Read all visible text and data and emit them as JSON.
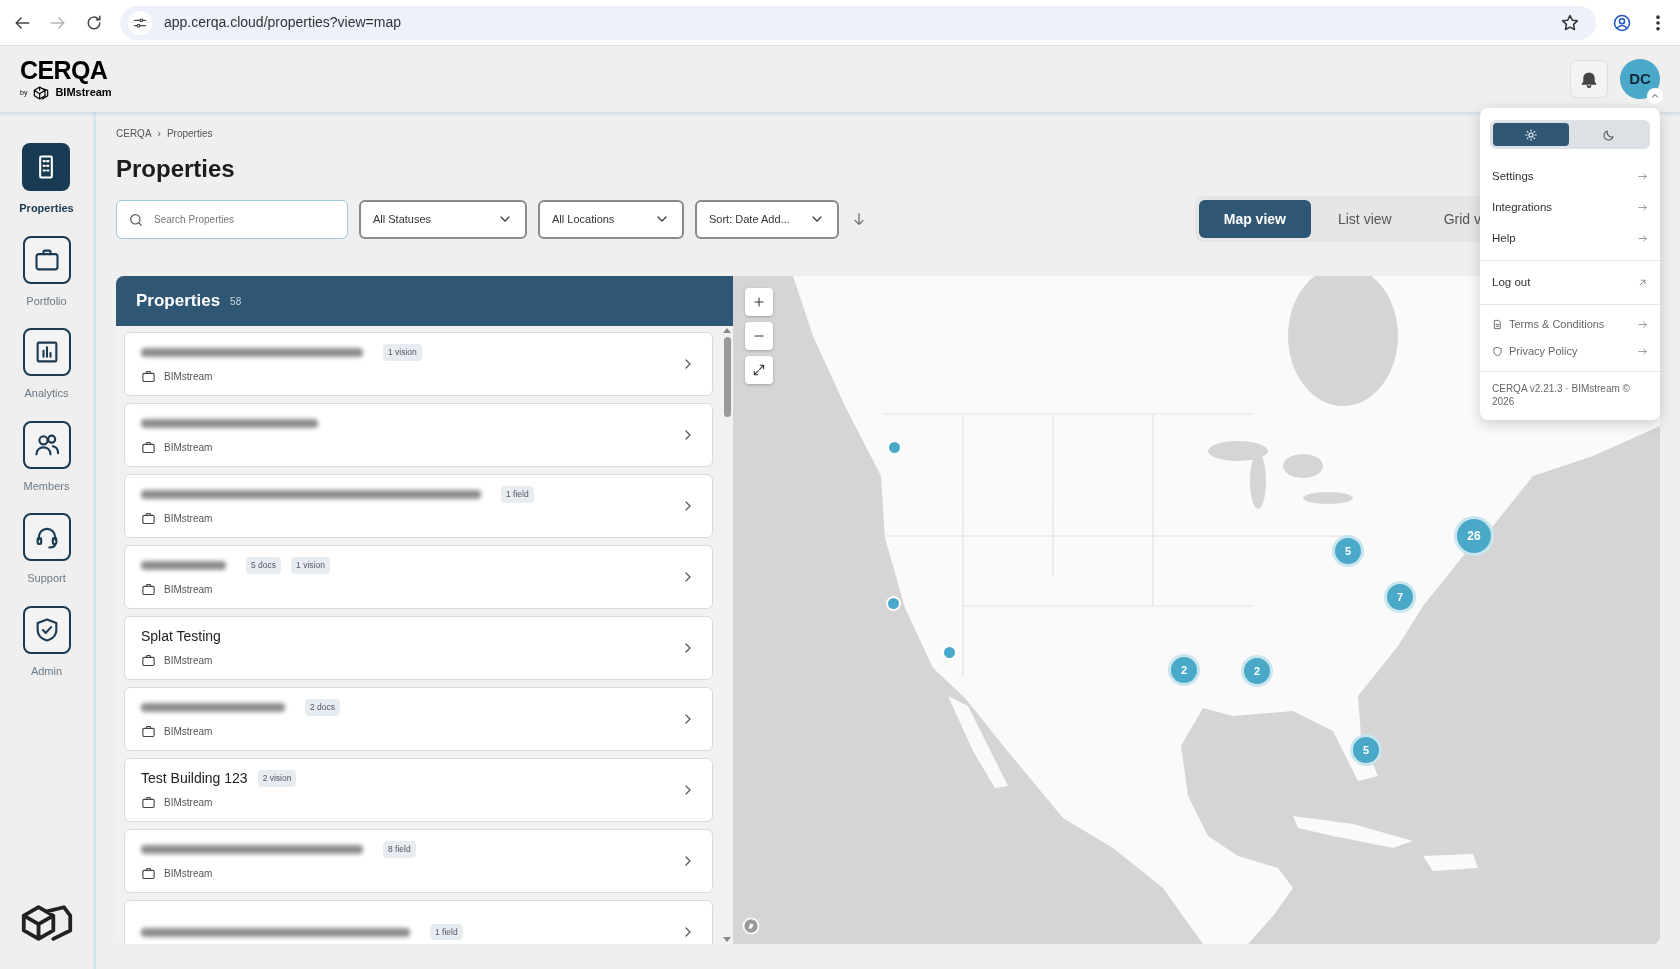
{
  "browser": {
    "url": "app.cerqa.cloud/properties?view=map",
    "forward_disabled": true
  },
  "header": {
    "logo": "CERQA",
    "logo_by": "by",
    "logo_brand": "BIMstream",
    "avatar_initials": "DC",
    "avatar_menu_open": true
  },
  "sidebar": {
    "items": [
      {
        "label": "Properties",
        "selected": true
      },
      {
        "label": "Portfolio",
        "selected": false
      },
      {
        "label": "Analytics",
        "selected": false
      },
      {
        "label": "Members",
        "selected": false
      },
      {
        "label": "Support",
        "selected": false
      },
      {
        "label": "Admin",
        "selected": false
      }
    ]
  },
  "breadcrumb": {
    "items": [
      "CERQA",
      "Properties"
    ],
    "separator": "›"
  },
  "page_title": "Properties",
  "filters": {
    "search_placeholder": "Search Properties",
    "dropdowns": [
      "All Statuses",
      "All Locations",
      "Sort: Date Add..."
    ]
  },
  "view_tabs": [
    {
      "label": "Map view",
      "selected": true
    },
    {
      "label": "List view",
      "selected": false
    },
    {
      "label": "Grid v",
      "selected": false
    }
  ],
  "properties_panel": {
    "title": "Properties",
    "count": "58",
    "items": [
      {
        "kind": "redacted",
        "badges": [
          "1 vision"
        ],
        "org": "BIMstream"
      },
      {
        "kind": "redacted",
        "org": "BIMstream"
      },
      {
        "kind": "redacted",
        "badges": [
          "1 field"
        ],
        "org": "BIMstream"
      },
      {
        "kind": "redacted",
        "badges": [
          "5 docs",
          "1 vision"
        ],
        "org": "BIMstream"
      },
      {
        "kind": "named",
        "title": "Splat Testing",
        "org": "BIMstream"
      },
      {
        "kind": "redacted",
        "badges": [
          "2 docs"
        ],
        "org": "BIMstream"
      },
      {
        "kind": "named",
        "title": "Test Building 123",
        "badges": [
          "2 vision"
        ],
        "org": "BIMstream"
      },
      {
        "kind": "redacted",
        "badges": [
          "8 field"
        ],
        "org": "BIMstream"
      },
      {
        "kind": "redacted",
        "badges": [
          "1 field"
        ]
      }
    ]
  },
  "map": {
    "markers": [
      {
        "kind": "point"
      },
      {
        "kind": "point"
      },
      {
        "kind": "point"
      },
      {
        "kind": "cluster",
        "count": "2"
      },
      {
        "kind": "cluster",
        "count": "2"
      },
      {
        "kind": "cluster",
        "count": "5"
      },
      {
        "kind": "cluster",
        "count": "7"
      },
      {
        "kind": "cluster",
        "count": "26"
      },
      {
        "kind": "cluster",
        "count": "5"
      }
    ]
  },
  "user_menu": {
    "theme_options": [
      {
        "kind": "light",
        "selected": true
      },
      {
        "kind": "dark",
        "selected": false
      }
    ],
    "sections": [
      [
        {
          "label": "Settings",
          "kind": "link"
        },
        {
          "label": "Integrations",
          "kind": "link"
        },
        {
          "label": "Help",
          "kind": "link"
        }
      ],
      [
        {
          "label": "Log out",
          "kind": "logout"
        }
      ],
      [
        {
          "label": "Terms & Conditions",
          "kind": "document"
        },
        {
          "label": "Privacy Policy",
          "kind": "policy"
        }
      ]
    ],
    "footer": "CERQA v2.21.3 · BIMstream © 2026"
  }
}
